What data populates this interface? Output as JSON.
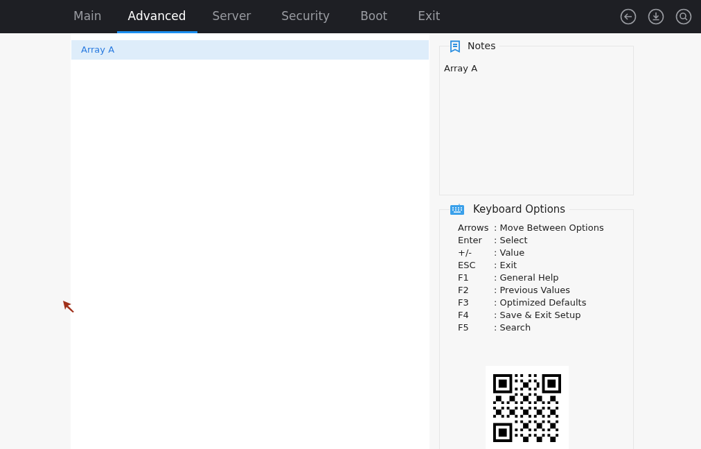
{
  "tabs": [
    {
      "label": "Main",
      "selected": false
    },
    {
      "label": "Advanced",
      "selected": true
    },
    {
      "label": "Server",
      "selected": false
    },
    {
      "label": "Security",
      "selected": false
    },
    {
      "label": "Boot",
      "selected": false
    },
    {
      "label": "Exit",
      "selected": false
    }
  ],
  "menu_items": [
    {
      "label": "Array A",
      "selected": true
    }
  ],
  "notes": {
    "title": "Notes",
    "text": "Array A"
  },
  "keyboard_options": {
    "title": "Keyboard Options",
    "items": [
      {
        "key": "Arrows",
        "action": ": Move Between Options"
      },
      {
        "key": "Enter",
        "action": ": Select"
      },
      {
        "key": "+/-",
        "action": ": Value"
      },
      {
        "key": "ESC",
        "action": ": Exit"
      },
      {
        "key": "F1",
        "action": ": General Help"
      },
      {
        "key": "F2",
        "action": ": Previous Values"
      },
      {
        "key": "F3",
        "action": ": Optimized Defaults"
      },
      {
        "key": "F4",
        "action": ": Save & Exit Setup"
      },
      {
        "key": "F5",
        "action": ": Search"
      }
    ]
  }
}
